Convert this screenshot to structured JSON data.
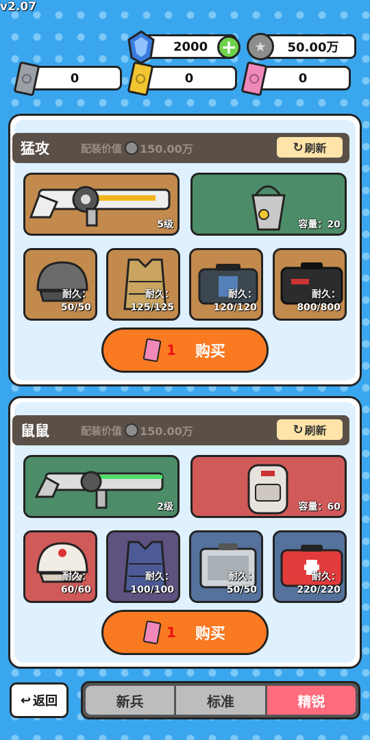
{
  "version": "v2.07",
  "currency": {
    "gems": "2000",
    "coins": "50.00万",
    "tickets": [
      {
        "icon": "gray-ticket-icon",
        "color": "#9aa0a6",
        "count": "0"
      },
      {
        "icon": "gold-ticket-icon",
        "color": "#f2c531",
        "count": "0"
      },
      {
        "icon": "pink-ticket-icon",
        "color": "#f089b9",
        "count": "0"
      }
    ]
  },
  "value_label": "配装价值",
  "refresh_label": "刷新",
  "buy_label": "购买",
  "loadouts": [
    {
      "name": "猛攻",
      "value": "150.00万",
      "weapon": {
        "icon": "orange-rifle-icon",
        "level": "5级",
        "bg": "#c38a4d"
      },
      "bag": {
        "icon": "gray-drawstring-bag-icon",
        "capacity": "容量：20",
        "bg": "#4d8c68"
      },
      "gear": [
        {
          "icon": "gray-helmet-icon",
          "bg": "#c38a4d",
          "label": "耐久：",
          "value": "50/50"
        },
        {
          "icon": "tan-vest-icon",
          "bg": "#c38a4d",
          "label": "耐久：",
          "value": "125/125"
        },
        {
          "icon": "dark-case-icon",
          "bg": "#c38a4d",
          "label": "耐久：",
          "value": "120/120"
        },
        {
          "icon": "black-case-icon",
          "bg": "#c38a4d",
          "label": "耐久：",
          "value": "800/800"
        }
      ],
      "buy_count": "1"
    },
    {
      "name": "鼠鼠",
      "value": "150.00万",
      "weapon": {
        "icon": "green-smg-icon",
        "level": "2级",
        "bg": "#4d8c68"
      },
      "bag": {
        "icon": "white-backpack-icon",
        "capacity": "容量：60",
        "bg": "#cf5a58"
      },
      "gear": [
        {
          "icon": "white-helmet-icon",
          "bg": "#cf5a58",
          "label": "耐久：",
          "value": "60/60"
        },
        {
          "icon": "blue-vest-icon",
          "bg": "#5f5280",
          "label": "耐久：",
          "value": "100/100"
        },
        {
          "icon": "silver-case-icon",
          "bg": "#55729c",
          "label": "耐久：",
          "value": "50/50"
        },
        {
          "icon": "red-case-icon",
          "bg": "#55729c",
          "label": "耐久：",
          "value": "220/220"
        }
      ],
      "buy_count": "1"
    }
  ],
  "back_label": "返回",
  "tabs": [
    {
      "label": "新兵",
      "active": false
    },
    {
      "label": "标准",
      "active": false
    },
    {
      "label": "精锐",
      "active": true
    }
  ]
}
